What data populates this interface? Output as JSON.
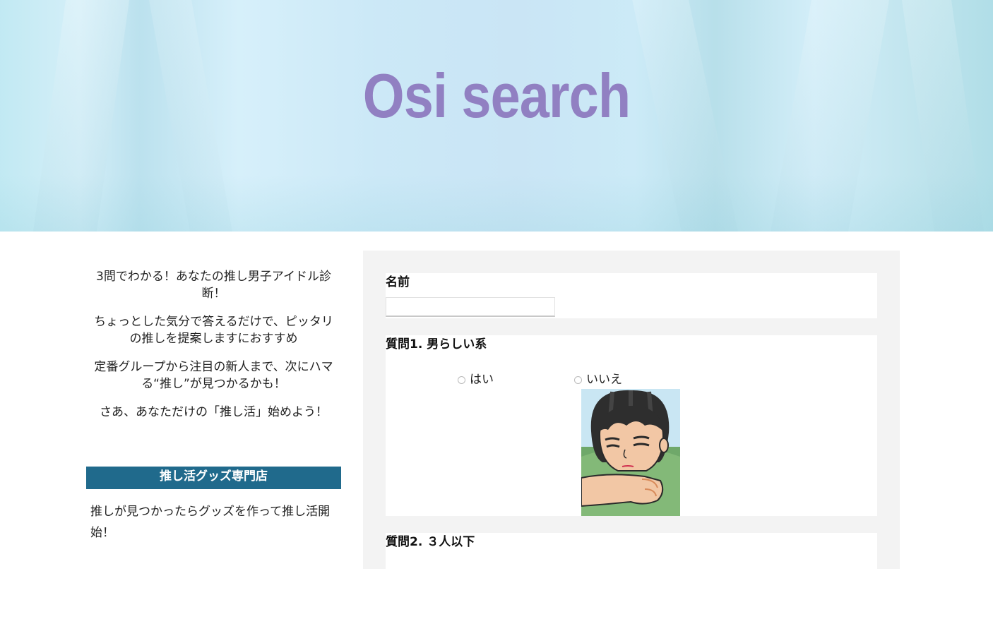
{
  "hero": {
    "title": "Osi search"
  },
  "intro": {
    "paragraphs": [
      "3問でわかる！あなたの推し男子アイドル診断！",
      "ちょっとした気分で答えるだけで、ピッタリの推しを提案しますにおすすめ",
      "定番グループから注目の新人まで、次にハマる“推し”が見つかるかも！",
      "さあ、あなただけの「推し活」始めよう！"
    ]
  },
  "shop": {
    "heading": "推し活グッズ専門店",
    "text": "推しが見つかったらグッズを作って推し活開始！"
  },
  "form": {
    "name_label": "名前",
    "name_value": "",
    "q1": {
      "label": "質問1. 男らしい系",
      "yes_label": "はい",
      "no_label": "いいえ",
      "illustration": "boy-resting-chin-illustration"
    },
    "q2": {
      "label": "質問2. ３人以下"
    }
  },
  "colors": {
    "title": "#9180c2",
    "shop_bar": "#206a8c",
    "panel_bg": "#f3f3f3"
  }
}
